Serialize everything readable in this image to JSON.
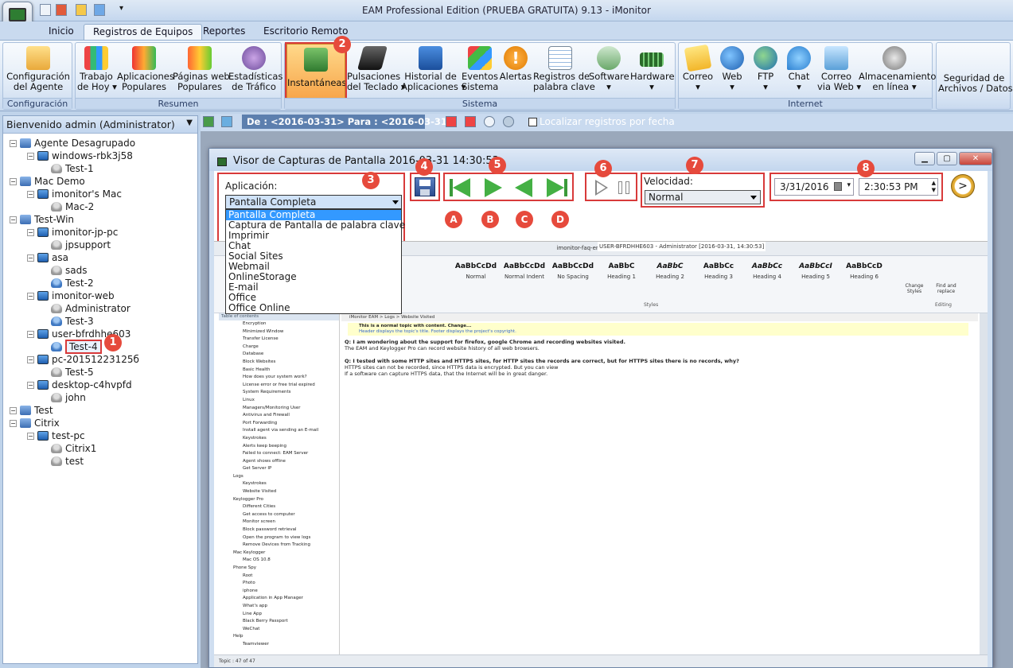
{
  "app": {
    "title": "EAM Professional Edition (PRUEBA GRATUITA) 9.13 - iMonitor"
  },
  "tabs": [
    "Inicio",
    "Registros de Equipos",
    "Reportes",
    "Escritorio Remoto"
  ],
  "ribbon": {
    "groups": [
      "Configuración",
      "Resumen",
      "Sistema",
      "Internet"
    ],
    "config": [
      "Configuración",
      "del Agente"
    ],
    "resumen": [
      [
        "Trabajo",
        "de Hoy ▾"
      ],
      [
        "Aplicaciones",
        "Populares"
      ],
      [
        "Páginas web",
        "Populares"
      ],
      [
        "Estadísticas",
        "de Tráfico"
      ]
    ],
    "sistema": [
      [
        "Instantáneas",
        ""
      ],
      [
        "Pulsaciones",
        "del Teclado ▾"
      ],
      [
        "Historial de",
        "Aplicaciones ▾"
      ],
      [
        "Eventos",
        "Sistema"
      ],
      [
        "Alertas",
        ""
      ],
      [
        "Registros de",
        "palabra clave"
      ],
      [
        "Software",
        "▾"
      ],
      [
        "Hardware",
        "▾"
      ]
    ],
    "internet": [
      [
        "Correo",
        "▾"
      ],
      [
        "Web",
        "▾"
      ],
      [
        "FTP",
        "▾"
      ],
      [
        "Chat",
        "▾"
      ],
      [
        "Correo",
        "via Web ▾"
      ],
      [
        "Almacenamiento",
        "en línea ▾"
      ]
    ],
    "security": [
      "Seguridad de",
      "Archivos / Datos ▾"
    ]
  },
  "left_panel": {
    "header": "Bienvenido admin (Administrator)",
    "tree": [
      {
        "label": "Agente Desagrupado",
        "level": 0,
        "icon": "group"
      },
      {
        "label": "windows-rbk3j58",
        "level": 1,
        "icon": "computer"
      },
      {
        "label": "Test-1",
        "level": 2,
        "icon": "user-offline"
      },
      {
        "label": "Mac Demo",
        "level": 0,
        "icon": "group"
      },
      {
        "label": "imonitor's Mac",
        "level": 1,
        "icon": "computer"
      },
      {
        "label": "Mac-2",
        "level": 2,
        "icon": "user-offline"
      },
      {
        "label": "Test-Win",
        "level": 0,
        "icon": "group"
      },
      {
        "label": "imonitor-jp-pc",
        "level": 1,
        "icon": "computer"
      },
      {
        "label": "jpsupport",
        "level": 2,
        "icon": "user-offline"
      },
      {
        "label": "asa",
        "level": 1,
        "icon": "computer"
      },
      {
        "label": "sads",
        "level": 2,
        "icon": "user-offline"
      },
      {
        "label": "Test-2",
        "level": 2,
        "icon": "user-online"
      },
      {
        "label": "imonitor-web",
        "level": 1,
        "icon": "computer"
      },
      {
        "label": "Administrator",
        "level": 2,
        "icon": "user-offline"
      },
      {
        "label": "Test-3",
        "level": 2,
        "icon": "user-online"
      },
      {
        "label": "user-bfrdhhe603",
        "level": 1,
        "icon": "computer"
      },
      {
        "label": "Test-4",
        "level": 2,
        "icon": "user-online"
      },
      {
        "label": "pc-20151223125б",
        "level": 1,
        "icon": "computer"
      },
      {
        "label": "Test-5",
        "level": 2,
        "icon": "user-offline"
      },
      {
        "label": "desktop-c4hvpfd",
        "level": 1,
        "icon": "computer"
      },
      {
        "label": "john",
        "level": 2,
        "icon": "user-offline"
      },
      {
        "label": "Test",
        "level": 0,
        "icon": "group"
      },
      {
        "label": "Citrix",
        "level": 0,
        "icon": "group"
      },
      {
        "label": "test-pc",
        "level": 1,
        "icon": "computer"
      },
      {
        "label": "Citrix1",
        "level": 2,
        "icon": "user-offline"
      },
      {
        "label": "test",
        "level": 2,
        "icon": "user-offline"
      }
    ]
  },
  "toolbar": {
    "date_range": "De : <2016-03-31> Para : <2016-03-31>",
    "locate_label": "Localizar registros por fecha"
  },
  "viewer": {
    "title": "Visor de Capturas de Pantalla 2016-03-31 14:30:53",
    "app_label": "Aplicación:",
    "app_selected": "Pantalla Completa",
    "app_options": [
      "Pantalla Completa",
      "Captura de Pantalla de palabra clave",
      "Imprimir",
      "Chat",
      "Social Sites",
      "Webmail",
      "OnlineStorage",
      "E-mail",
      "Office",
      "Office Online"
    ],
    "speed_label": "Velocidad:",
    "speed_value": "Normal",
    "date_value": "3/31/2016",
    "time_value": "2:30:53 PM"
  },
  "callouts": {
    "numbers": [
      "1",
      "2",
      "3",
      "4",
      "5",
      "6",
      "7",
      "8"
    ],
    "letters": [
      "A",
      "B",
      "C",
      "D"
    ]
  },
  "screenshot": {
    "window_title": "imonitor-faq-en.hnd - HelpNDoc",
    "user_overlay": "USER-BFRDHHE603 - Administrator [2016-03-31, 14:30:53]",
    "styles": [
      [
        "AaBbCcDd",
        "Normal"
      ],
      [
        "AaBbCcDd",
        "Normal Indent"
      ],
      [
        "AaBbCcDd",
        "No Spacing"
      ],
      [
        "AaBbC",
        "Heading 1"
      ],
      [
        "AaBbC",
        "Heading 2"
      ],
      [
        "AaBbCc",
        "Heading 3"
      ],
      [
        "AaBbCc",
        "Heading 4"
      ],
      [
        "AaBbCcI",
        "Heading 5"
      ],
      [
        "AaBbCcD",
        "Heading 6"
      ]
    ],
    "styles_group": "Styles",
    "change_styles": "Change Styles",
    "find_replace": "Find and replace",
    "editing": "Editing",
    "toc_title": "Table of contents",
    "toc": [
      "Encryption",
      "Minimized Window",
      "Transfer License",
      "Charge",
      "Database",
      "Block Websites",
      "Basic Health",
      "How does your system work?",
      "License error or free trial expired",
      "System Requirements",
      "Linux",
      "Managers/Monitoring User",
      "Antivirus and Firewall",
      "Port Forwarding",
      "Install agent via sending an E-mail",
      "Keystrokes",
      "Alerts keep beeping",
      "Failed to connect: EAM Server",
      "Agent shows offline",
      "Get Server IP",
      "Logs",
      "Keystrokes",
      "Website Visited",
      "Keylogger Pro",
      "Different Cities",
      "Get access to computer",
      "Monitor screen",
      "Block password retrieval",
      "Open the program to view logs",
      "Remove Devices from Tracking",
      "Mac Keylogger",
      "Mac OS 10.8",
      "Phone Spy",
      "Root",
      "Photo",
      "iphone",
      "Application in App Manager",
      "What's app",
      "Line App",
      "Black Berry Passport",
      "WeChat",
      "Help",
      "Teamviewer"
    ],
    "breadcrumb": "iMonitor EAM  >  Logs  >  Website Visited",
    "note1": "This is a normal topic with content.  Change...",
    "note2": "Header displays the topic's title.  Footer displays the project's copyright.",
    "q1": "Q: I am wondering about the support for firefox, google Chrome and recording websites visited.",
    "a1": "The EAM and Keylogger Pro can record website history of all web browsers.",
    "q2": "Q: I tested with some HTTP sites and HTTPS sites, for HTTP sites the records are correct, but for HTTPS sites there is no records, why?",
    "a2a": "HTTPS sites can not be recorded, since HTTPS data is encrypted. But you can view",
    "a2b": "If a software can capture HTTPS data, that the Internet will be in great danger.",
    "status": "Topic : 47 of 47"
  }
}
